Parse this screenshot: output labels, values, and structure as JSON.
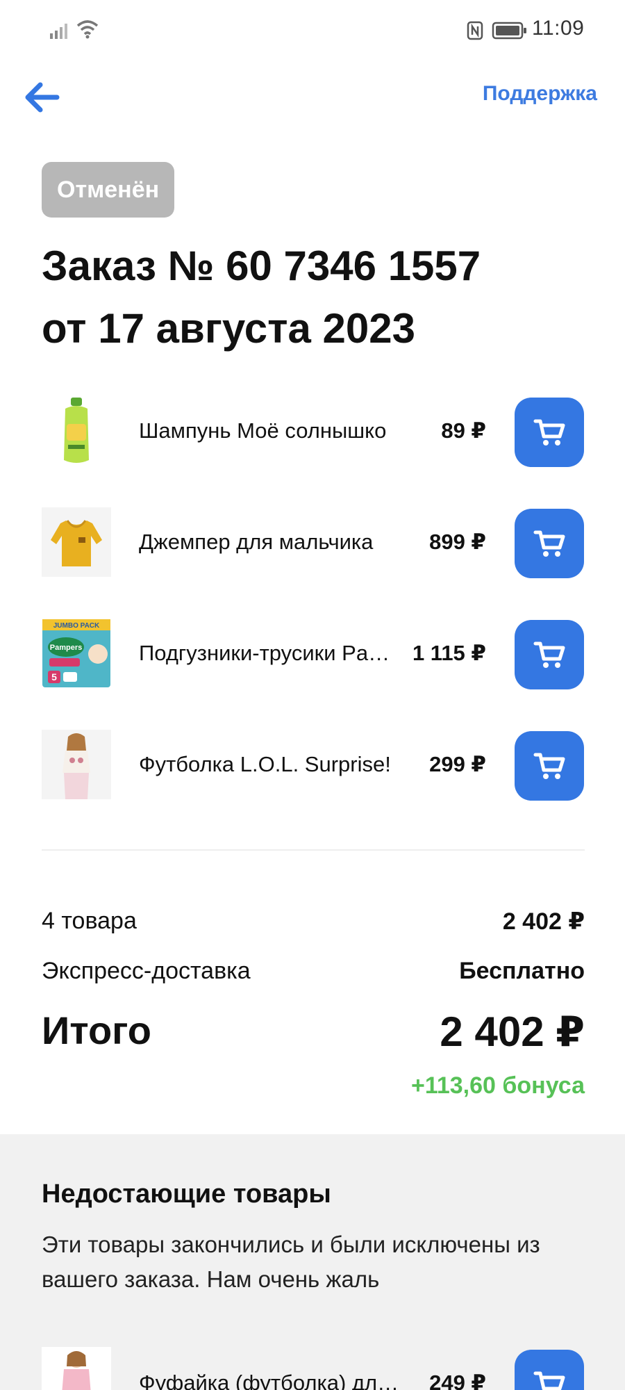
{
  "status_bar": {
    "time": "11:09",
    "icons": [
      "signal-icon",
      "wifi-icon",
      "nfc-icon",
      "battery-icon"
    ]
  },
  "header": {
    "back_icon": "arrow-left-icon",
    "support_label": "Поддержка"
  },
  "order": {
    "status": "Отменён",
    "title_line1": "Заказ № 60 7346 1557",
    "title_line2": "от 17 августа 2023"
  },
  "items": [
    {
      "name": "Шампунь Моё солнышко",
      "price": "89 ₽",
      "thumb": "shampoo-bottle"
    },
    {
      "name": "Джемпер для мальчика",
      "price": "899 ₽",
      "thumb": "yellow-sweater"
    },
    {
      "name": "Подгузники-трусики Pampers",
      "price": "1 115 ₽",
      "thumb": "diaper-pack"
    },
    {
      "name": "Футболка L.O.L. Surprise!",
      "price": "299 ₽",
      "thumb": "girl-tshirt"
    }
  ],
  "summary": {
    "count_label": "4 товара",
    "count_value": "2 402 ₽",
    "delivery_label": "Экспресс-доставка",
    "delivery_value": "Бесплатно",
    "total_label": "Итого",
    "total_value": "2 402 ₽",
    "bonus": "+113,60 бонуса"
  },
  "missing": {
    "title": "Недостающие товары",
    "description": "Эти товары закончились и были исключены из вашего заказа. Нам очень жаль",
    "items": [
      {
        "name": "Фуфайка (футболка) для девочки",
        "price": "249 ₽",
        "thumb": "girl-shirt"
      }
    ]
  },
  "colors": {
    "accent": "#3477e2",
    "link": "#3d7be0",
    "badge_bg": "#b7b7b7",
    "bonus": "#57c157",
    "section_bg": "#f1f1f1"
  }
}
